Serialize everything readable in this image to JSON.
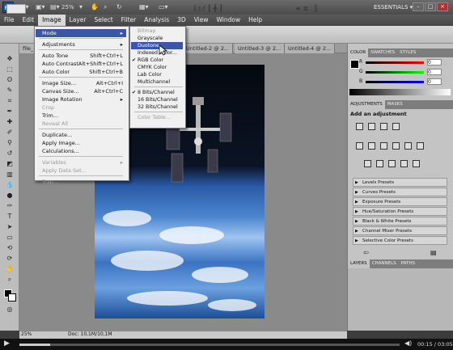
{
  "app": {
    "logo": "Ps",
    "zoom": "25%",
    "workspace": "ESSENTIALS ▾"
  },
  "menubar": [
    "File",
    "Edit",
    "Image",
    "Layer",
    "Select",
    "Filter",
    "Analysis",
    "3D",
    "View",
    "Window",
    "Help"
  ],
  "doc_tabs": [
    "file_...",
    "Untitled-2 @ 2...",
    "Untitled-3 @ 2...",
    "Untitled-4 @ 2..."
  ],
  "image_menu": {
    "items": [
      {
        "label": "Mode",
        "shortcut": "",
        "submenu": true,
        "state": "highlight"
      },
      {
        "sep": true
      },
      {
        "label": "Adjustments",
        "shortcut": "",
        "submenu": true,
        "state": ""
      },
      {
        "sep": true
      },
      {
        "label": "Auto Tone",
        "shortcut": "Shift+Ctrl+L",
        "state": ""
      },
      {
        "label": "Auto Contrast",
        "shortcut": "Alt+Shift+Ctrl+L",
        "state": ""
      },
      {
        "label": "Auto Color",
        "shortcut": "Shift+Ctrl+B",
        "state": ""
      },
      {
        "sep": true
      },
      {
        "label": "Image Size...",
        "shortcut": "Alt+Ctrl+I",
        "state": ""
      },
      {
        "label": "Canvas Size...",
        "shortcut": "Alt+Ctrl+C",
        "state": ""
      },
      {
        "label": "Image Rotation",
        "shortcut": "",
        "submenu": true,
        "state": ""
      },
      {
        "label": "Crop",
        "shortcut": "",
        "state": "disabled"
      },
      {
        "label": "Trim...",
        "shortcut": "",
        "state": ""
      },
      {
        "label": "Reveal All",
        "shortcut": "",
        "state": "disabled"
      },
      {
        "sep": true
      },
      {
        "label": "Duplicate...",
        "shortcut": "",
        "state": ""
      },
      {
        "label": "Apply Image...",
        "shortcut": "",
        "state": ""
      },
      {
        "label": "Calculations...",
        "shortcut": "",
        "state": ""
      },
      {
        "sep": true
      },
      {
        "label": "Variables",
        "shortcut": "",
        "submenu": true,
        "state": "disabled"
      },
      {
        "label": "Apply Data Set...",
        "shortcut": "",
        "state": "disabled"
      },
      {
        "sep": true
      },
      {
        "label": "Trap...",
        "shortcut": "",
        "state": "disabled"
      }
    ]
  },
  "mode_menu": {
    "items": [
      {
        "label": "Bitmap",
        "state": "disabled",
        "checked": false
      },
      {
        "label": "Grayscale",
        "state": "",
        "checked": false
      },
      {
        "label": "Duotone",
        "state": "highlight",
        "checked": false
      },
      {
        "label": "Indexed Color...",
        "state": "",
        "checked": false
      },
      {
        "label": "RGB Color",
        "state": "",
        "checked": true
      },
      {
        "label": "CMYK Color",
        "state": "",
        "checked": false
      },
      {
        "label": "Lab Color",
        "state": "",
        "checked": false
      },
      {
        "label": "Multichannel",
        "state": "",
        "checked": false
      },
      {
        "sep": true
      },
      {
        "label": "8 Bits/Channel",
        "state": "",
        "checked": true
      },
      {
        "label": "16 Bits/Channel",
        "state": "",
        "checked": false
      },
      {
        "label": "32 Bits/Channel",
        "state": "",
        "checked": false
      },
      {
        "sep": true
      },
      {
        "label": "Color Table...",
        "state": "disabled",
        "checked": false
      }
    ]
  },
  "color_panel": {
    "tabs": [
      "COLOR",
      "SWATCHES",
      "STYLES"
    ],
    "channels": [
      "R",
      "G",
      "B"
    ],
    "values": [
      "0",
      "0",
      "0"
    ]
  },
  "adjustments_panel": {
    "tabs": [
      "ADJUSTMENTS",
      "MASKS"
    ],
    "heading": "Add an adjustment",
    "presets": [
      "Levels Presets",
      "Curves Presets",
      "Exposure Presets",
      "Hue/Saturation Presets",
      "Black & White Presets",
      "Channel Mixer Presets",
      "Selective Color Presets"
    ]
  },
  "layers_panel": {
    "tabs": [
      "LAYERS",
      "CHANNELS",
      "PATHS"
    ]
  },
  "statusbar": {
    "zoom": "25%",
    "doc": "Doc: 10,1M/10,1M"
  },
  "player": {
    "timecode": "00:15 / 03:05",
    "progress": 0.08
  }
}
